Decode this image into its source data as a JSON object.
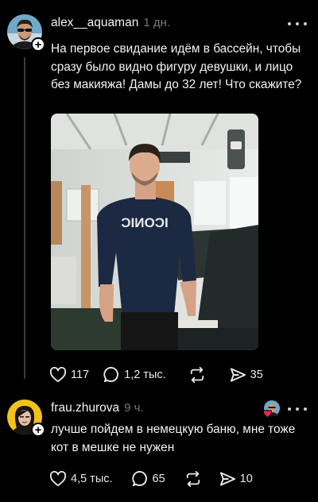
{
  "posts": [
    {
      "username": "alex__aquaman",
      "time": "1 дн.",
      "text": "На первое свидание идём в бассейн, чтобы сразу было видно фигуру девушки, и лицо без макияжа! Дамы до 32 лет! Что скажите?",
      "photo_shirt_text": "ICONIC",
      "likes": "117",
      "comments": "1,2 тыс.",
      "shares": "35",
      "icons": {
        "like": "heart-icon",
        "comment": "comment-bubble-icon",
        "repost": "repost-icon",
        "share": "send-icon",
        "more": "more-dots-icon",
        "follow": "plus-icon"
      }
    },
    {
      "username": "frau.zhurova",
      "time": "9 ч.",
      "text": "лучше пойдем в немецкую баню, мне тоже кот в мешке не нужен",
      "likes": "4,5 тыс.",
      "comments": "65",
      "shares": "10",
      "icons": {
        "like": "heart-icon",
        "comment": "comment-bubble-icon",
        "repost": "repost-icon",
        "share": "send-icon",
        "more": "more-dots-icon",
        "liked_by_author": "red-heart-icon"
      }
    }
  ],
  "colors": {
    "background": "#000000",
    "text": "#f3f3f3",
    "muted": "#777777",
    "thread_line": "#3a3a3a",
    "heart": "#e0245e"
  }
}
